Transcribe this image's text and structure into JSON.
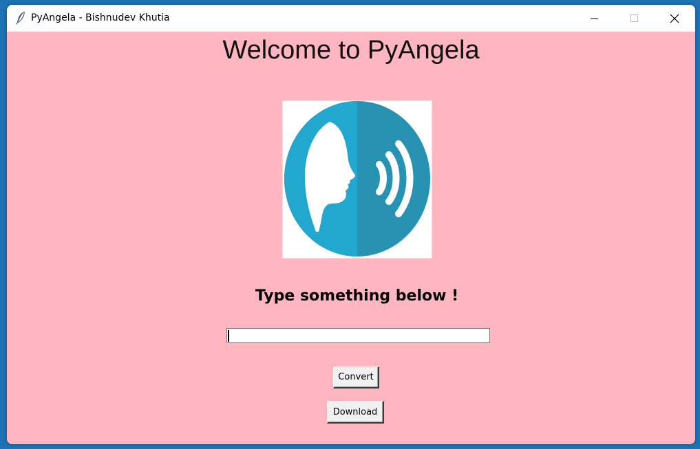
{
  "window": {
    "title": "PyAngela - Bishnudev Khutia",
    "controls": {
      "minimize_icon": "minimize-icon",
      "maximize_icon": "maximize-icon",
      "close_icon": "close-icon"
    }
  },
  "main": {
    "heading": "Welcome to PyAngela",
    "logo_icon": "speaking-head-icon",
    "prompt": "Type something below !",
    "input": {
      "value": "",
      "placeholder": ""
    },
    "convert_label": "Convert",
    "download_label": "Download"
  },
  "colors": {
    "background": "#ffb6c1",
    "logo_light": "#22a8cf",
    "logo_dark": "#2892b2"
  }
}
